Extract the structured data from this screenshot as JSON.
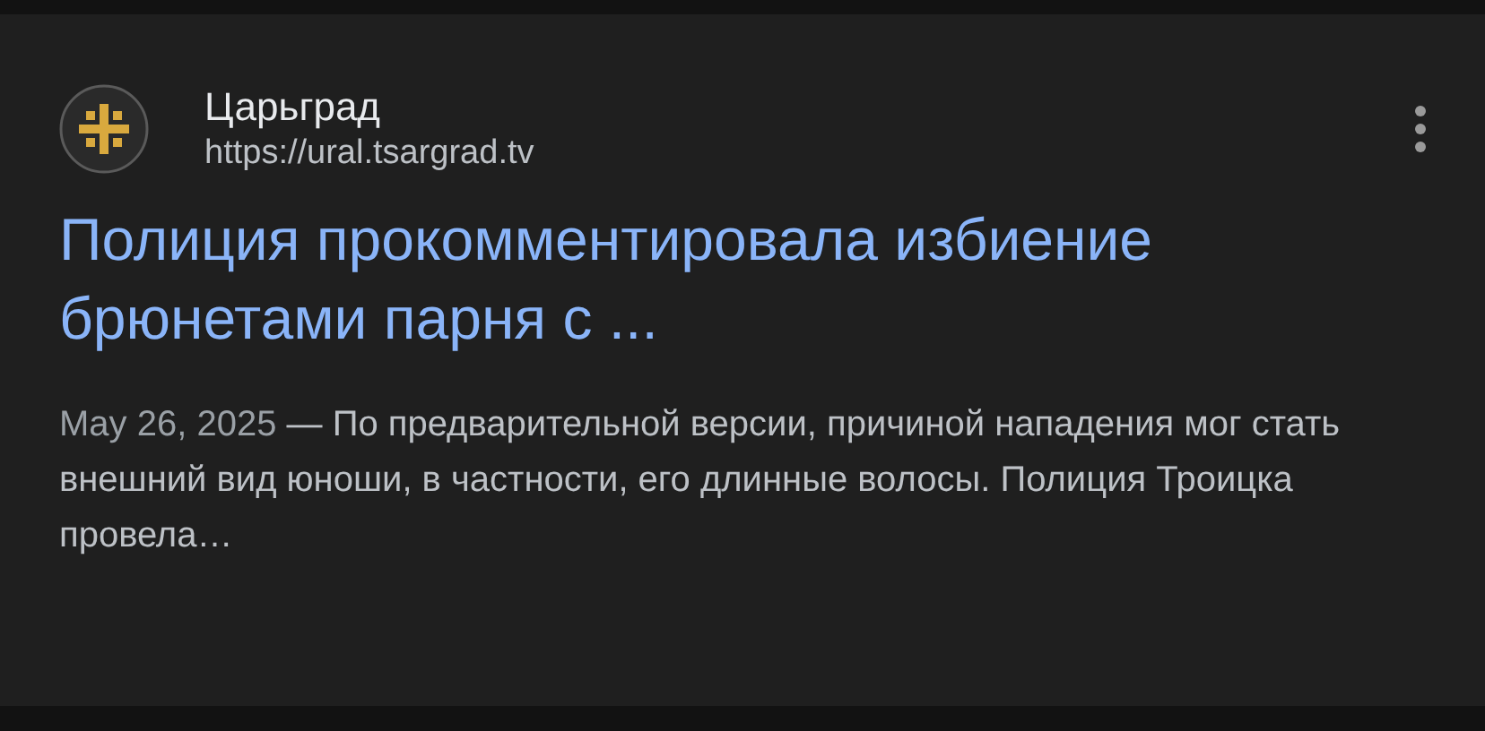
{
  "result": {
    "source": {
      "name": "Царьград",
      "url": "https://ural.tsargrad.tv"
    },
    "title": "Полиция прокомментировала избиение брюнетами парня с ...",
    "snippet": {
      "date": "May 26, 2025",
      "separator": "—",
      "text": "По предварительной версии, причиной нападения мог стать внешний вид юноши, в частности, его длинные волосы. Полиция Троицка провела…"
    }
  }
}
